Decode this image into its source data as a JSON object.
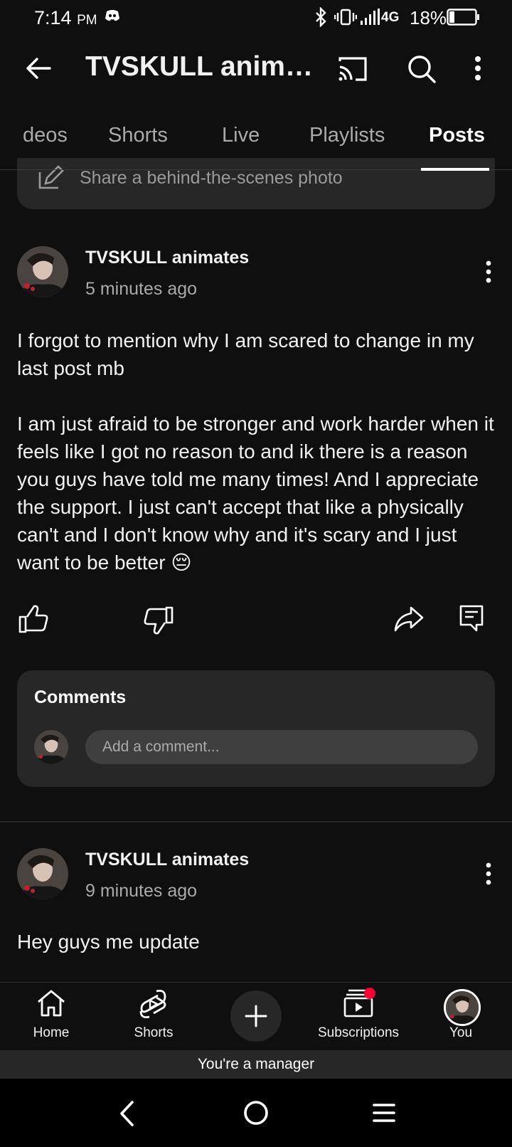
{
  "status_bar": {
    "time": "7:14",
    "ampm": "PM",
    "network": "4G",
    "battery": "18%"
  },
  "app_bar": {
    "title": "TVSKULL animates",
    "icons": [
      "back-arrow-icon",
      "cast-icon",
      "search-icon",
      "more-vert-icon"
    ]
  },
  "tabs": [
    {
      "label": "deos",
      "active": false
    },
    {
      "label": "Shorts",
      "active": false
    },
    {
      "label": "Live",
      "active": false
    },
    {
      "label": "Playlists",
      "active": false
    },
    {
      "label": "Posts",
      "active": true
    }
  ],
  "composer": {
    "placeholder": "Share a behind-the-scenes photo"
  },
  "posts": [
    {
      "author": "TVSKULL animates",
      "time": "5 minutes ago",
      "paragraph1": "I forgot to mention why I am scared to change in my last post mb",
      "paragraph2": "I am just afraid to be stronger and work harder when it feels like I got no reason to and ik there is a reason you guys have told me many times! And I appreciate the support. I just can't accept that like a physically can't and I don't know why and it's scary and I just want to be better 😔",
      "comments": {
        "title": "Comments",
        "placeholder": "Add a comment..."
      }
    },
    {
      "author": "TVSKULL animates",
      "time": "9 minutes ago",
      "paragraph1": "Hey guys me update"
    }
  ],
  "bottom_nav": {
    "home": "Home",
    "shorts": "Shorts",
    "subscriptions": "Subscriptions",
    "you": "You"
  },
  "manager_banner": "You're a manager",
  "colors": {
    "background": "#0f0f0f",
    "surface": "#272727",
    "text_primary": "#f1f1f1",
    "text_secondary": "#aaaaaa",
    "notification_dot": "#ff0033"
  }
}
